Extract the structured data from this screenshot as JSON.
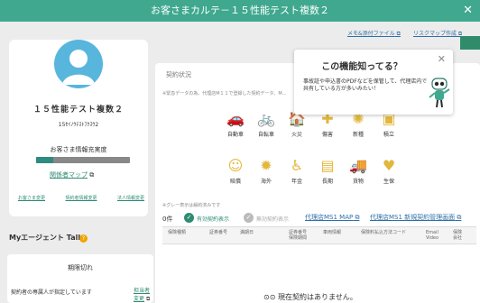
{
  "window": {
    "title": "お客さまカルテ－１５性能テスト複数２",
    "close_icon": "close-icon"
  },
  "customer": {
    "name": "１５性能テスト複数２",
    "kana": "15ｾｲﾉｳﾃｽﾄﾌｸｽｳ2",
    "info_label": "お客さま情報充実度",
    "info_progress_pct": 18,
    "relation_map": "関係者マップ",
    "links": [
      "お客さま変更",
      "契約者情報変更",
      "法人情報変更"
    ]
  },
  "top_links": {
    "memo": "メモ&添付ファイル",
    "risk_map": "リスクマップ作成"
  },
  "contract": {
    "title": "契約状況",
    "note": "※緊急データの為、代理店M１１で登録した契約データ、M…",
    "items": [
      {
        "label": "自動車",
        "icon": "car-icon"
      },
      {
        "label": "自転車",
        "icon": "bicycle-icon"
      },
      {
        "label": "火災",
        "icon": "fire-icon"
      },
      {
        "label": "傷害",
        "icon": "injury-icon"
      },
      {
        "label": "新種",
        "icon": "new-type-icon"
      },
      {
        "label": "積立",
        "icon": "savings-icon"
      },
      {
        "label": "賠償",
        "icon": "liability-icon"
      },
      {
        "label": "海外",
        "icon": "overseas-icon"
      },
      {
        "label": "年金",
        "icon": "pension-icon"
      },
      {
        "label": "長期",
        "icon": "long-term-icon"
      },
      {
        "label": "貨物",
        "icon": "cargo-icon"
      },
      {
        "label": "生保",
        "icon": "life-insurance-icon"
      }
    ]
  },
  "list": {
    "grey_note": "※グレー表示は解約済みです",
    "count": "0件",
    "valid_label": "有効契約表示",
    "invalid_label": "無効契約表示",
    "agent_ms1_map": "代理店MS1 MAP",
    "agent_ms1_new": "代理店MS1 新規契約管理画面",
    "columns": [
      "保険種類",
      "証券番号",
      "満期日",
      "証券番号\n保険期間",
      "車両情報",
      "保険料払込方法コード",
      "Email\nVideo",
      "保険\n会社"
    ],
    "empty_message": "現在契約はありません。"
  },
  "talk": {
    "header": "Myエージェント Talk",
    "status": "期限切れ",
    "message": "契約者の専属人が指定しています",
    "change_owner": "担当者変更"
  },
  "popup": {
    "title": "この機能知ってる？",
    "body": "事故証や申込書のPDFなどを保管して、代理店内で共有している方が多いみたい！",
    "close_icon": "close-icon"
  },
  "colors": {
    "header_green": "#3fa88f",
    "link_blue": "#2e6fa8",
    "gold": "#e2b73d"
  }
}
